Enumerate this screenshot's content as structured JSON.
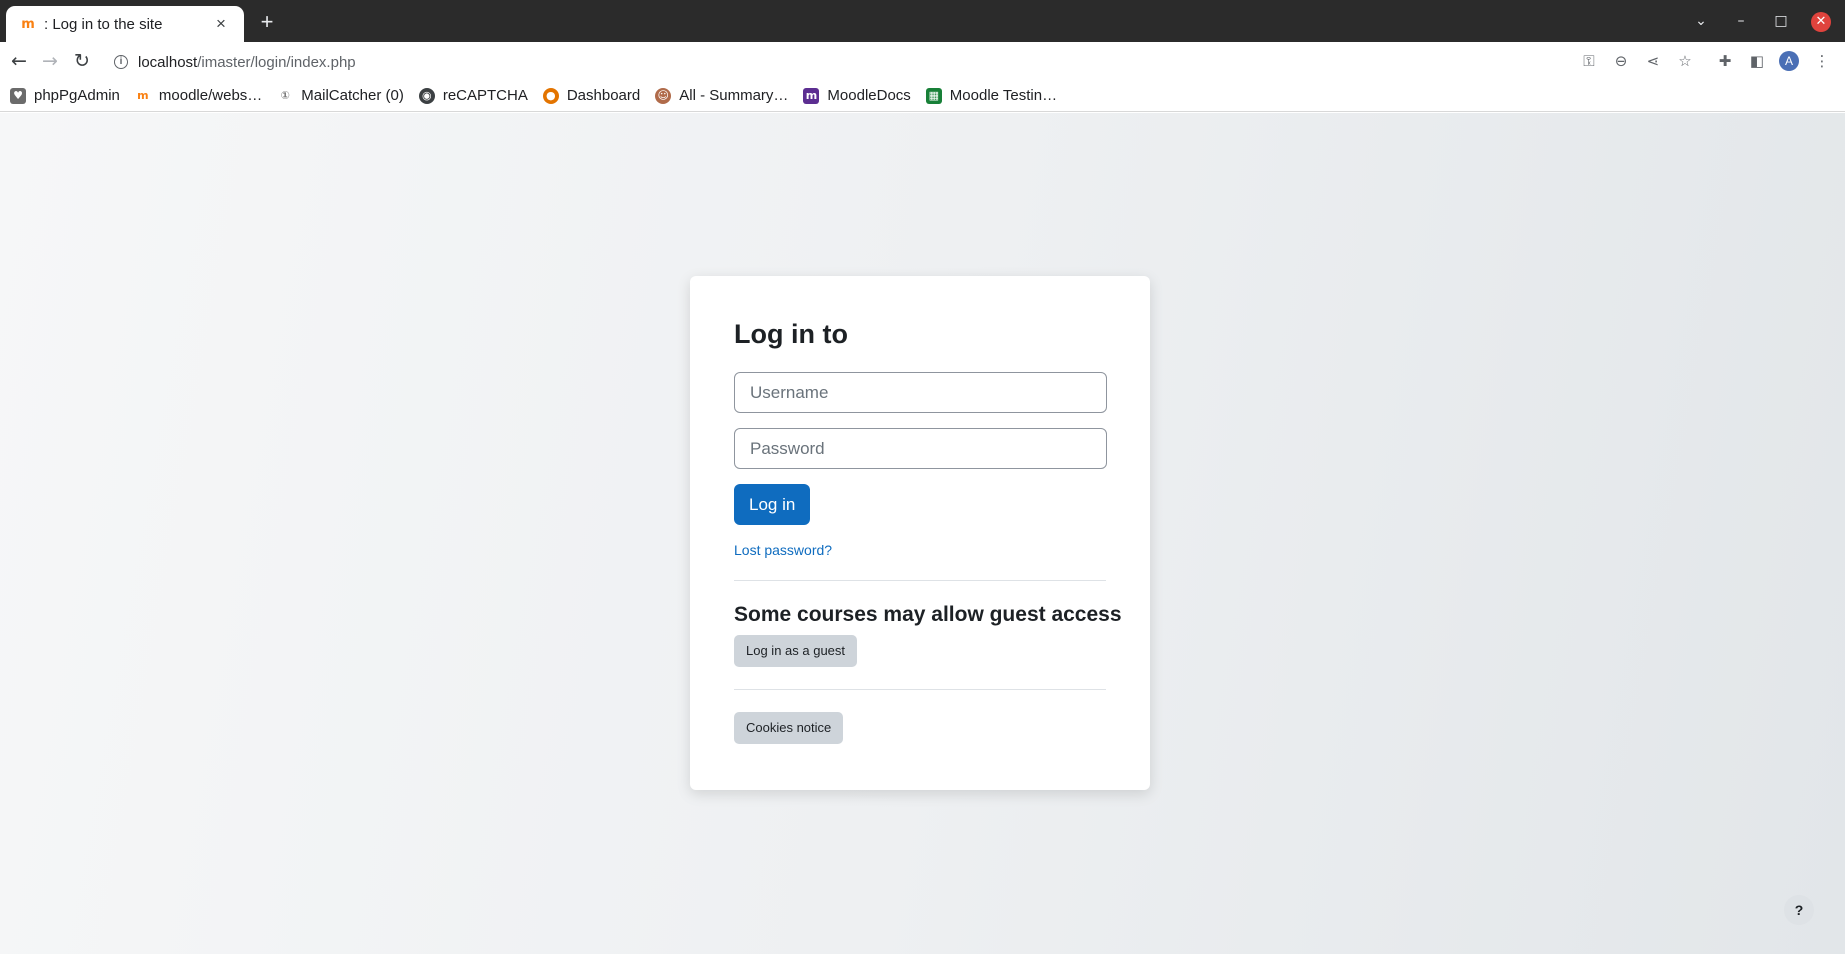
{
  "browser": {
    "tab_title": ": Log in to the site",
    "tab_close_icon": "×",
    "new_tab_icon": "+",
    "url_host": "localhost",
    "url_path": "/imaster/login/index.php",
    "avatar_letter": "A"
  },
  "bookmarks": [
    {
      "label": "phpPgAdmin",
      "icon": "elephant-icon",
      "color": "#6b6b6b"
    },
    {
      "label": "moodle/webs…",
      "icon": "moodle-icon",
      "color": "#f98012"
    },
    {
      "label": "MailCatcher (0)",
      "icon": "mailcatcher-icon",
      "color": "#7b7b7b"
    },
    {
      "label": "reCAPTCHA",
      "icon": "globe-icon",
      "color": "#3c4043"
    },
    {
      "label": "Dashboard",
      "icon": "dashboard-icon",
      "color": "#e37400"
    },
    {
      "label": "All - Summary…",
      "icon": "person-icon",
      "color": "#b06b4a"
    },
    {
      "label": "MoodleDocs",
      "icon": "moodledocs-icon",
      "color": "#5c2e91"
    },
    {
      "label": "Moodle Testin…",
      "icon": "sheets-icon",
      "color": "#188038"
    }
  ],
  "login": {
    "heading": "Log in to",
    "username_placeholder": "Username",
    "password_placeholder": "Password",
    "login_button": "Log in",
    "lost_password": "Lost password?",
    "guest_heading": "Some courses may allow guest access",
    "guest_button": "Log in as a guest",
    "cookies_button": "Cookies notice"
  },
  "help_button": "?"
}
